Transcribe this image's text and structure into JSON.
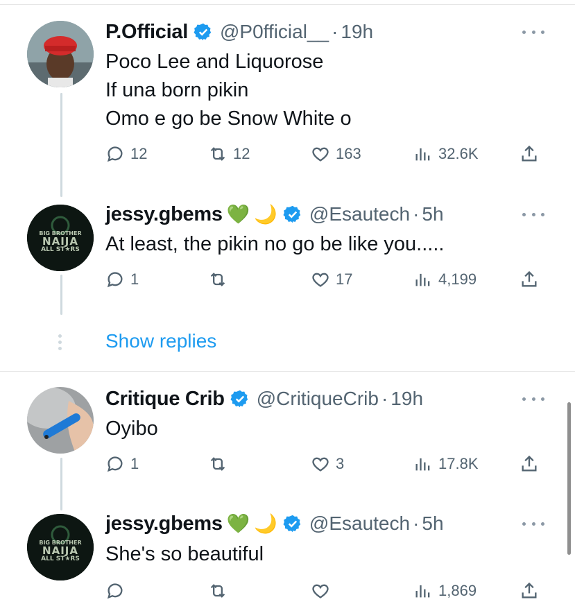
{
  "colors": {
    "accent": "#1d9bf0",
    "muted": "#536471",
    "text": "#0f1419",
    "emoji_heart": "#4cd137"
  },
  "tweets": [
    {
      "name": "P.Official",
      "handle": "@P0fficial__",
      "dot": "·",
      "time": "19h",
      "lines": [
        "Poco Lee and Liquorose",
        "If una born pikin",
        "Omo e go be Snow White o"
      ],
      "replies": "12",
      "retweets": "12",
      "likes": "163",
      "views": "32.6K"
    },
    {
      "name": "jessy.gbems",
      "emoji1": "💚",
      "emoji2": "🌙",
      "handle": "@Esautech",
      "dot": "·",
      "time": "5h",
      "lines": [
        "At least, the pikin no go be like you....."
      ],
      "replies": "1",
      "retweets": "",
      "likes": "17",
      "views": "4,199",
      "avatar_text": [
        "BIG BROTHER",
        "NAIJA",
        "ALL ST★RS"
      ]
    },
    {
      "name": "Critique Crib",
      "handle": "@CritiqueCrib",
      "dot": "·",
      "time": "19h",
      "lines": [
        "Oyibo"
      ],
      "replies": "1",
      "retweets": "",
      "likes": "3",
      "views": "17.8K"
    },
    {
      "name": "jessy.gbems",
      "emoji1": "💚",
      "emoji2": "🌙",
      "handle": "@Esautech",
      "dot": "·",
      "time": "5h",
      "lines": [
        "She's so beautiful"
      ],
      "replies": "",
      "retweets": "",
      "likes": "",
      "views": "1,869",
      "avatar_text": [
        "BIG BROTHER",
        "NAIJA",
        "ALL ST★RS"
      ]
    }
  ],
  "show_replies": "Show replies",
  "icons": [
    "verified-badge-icon",
    "more-options-icon",
    "reply-icon",
    "retweet-icon",
    "like-icon",
    "views-icon",
    "share-icon"
  ]
}
